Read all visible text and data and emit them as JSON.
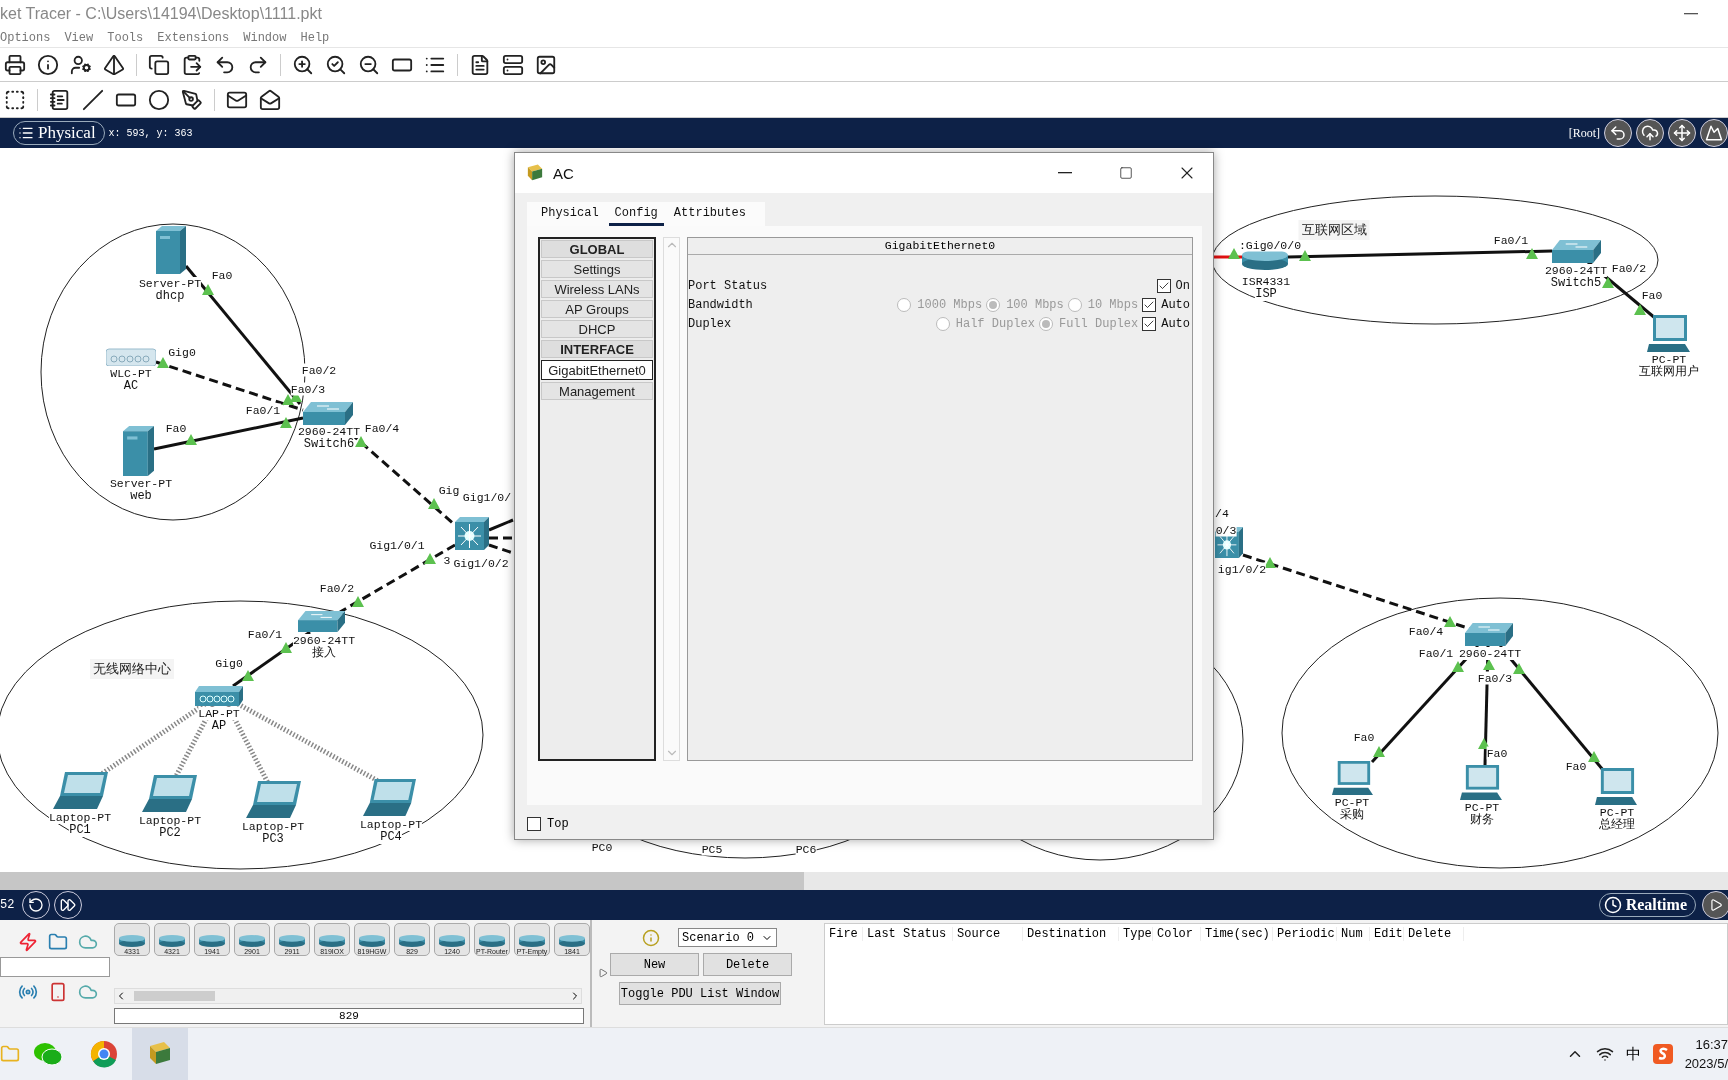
{
  "window": {
    "title": "ket Tracer - C:\\Users\\14194\\Desktop\\1111.pkt"
  },
  "menu": [
    "Options",
    "View",
    "Tools",
    "Extensions",
    "Window",
    "Help"
  ],
  "canvas_bar": {
    "mode": "Physical",
    "coords": "x: 593, y: 363",
    "path": "[Root]"
  },
  "canvas": {
    "nodes": [
      {
        "kind": "server",
        "model": "Server-PT",
        "name": "dhcp"
      },
      {
        "kind": "wlc",
        "model": "WLC-PT",
        "name": "AC"
      },
      {
        "kind": "server",
        "model": "Server-PT",
        "name": "web"
      },
      {
        "kind": "switch",
        "model": "2960-24TT",
        "name": "Switch6"
      },
      {
        "kind": "multilayer"
      },
      {
        "kind": "switch",
        "model": "2960-24TT",
        "name": "接入"
      },
      {
        "kind": "ap",
        "model": "LAP-PT",
        "name": "AP"
      },
      {
        "kind": "laptop",
        "model": "Laptop-PT",
        "name": "PC1"
      },
      {
        "kind": "laptop",
        "model": "Laptop-PT",
        "name": "PC2"
      },
      {
        "kind": "laptop",
        "model": "Laptop-PT",
        "name": "PC3"
      },
      {
        "kind": "laptop",
        "model": "Laptop-PT",
        "name": "PC4"
      },
      {
        "kind": "router",
        "model": "ISR4331",
        "name": "ISP"
      },
      {
        "kind": "switch",
        "model": "2960-24TT",
        "name": "Switch5"
      },
      {
        "kind": "pc",
        "model": "PC-PT",
        "name": "互联网用户"
      },
      {
        "kind": "multilayer"
      },
      {
        "kind": "switch",
        "model": "2960-24TT"
      },
      {
        "kind": "pc",
        "model": "PC-PT",
        "name": "采购"
      },
      {
        "kind": "pc",
        "model": "PC-PT",
        "name": "财务"
      },
      {
        "kind": "pc",
        "model": "PC-PT",
        "name": "总经理"
      }
    ],
    "area_labels": [
      "无线网络中心",
      "互联网区域"
    ],
    "labels": [
      "Fa0",
      "Gig0",
      "Fa0/2",
      "Fa0/3",
      "Fa0/1",
      "Fa0",
      "Fa0/4",
      "Gig",
      "Gig1/0/",
      "Gig1/0/1",
      "3",
      "Gig1/0/2",
      "Fa0/2",
      "Fa0/1",
      "Gig0",
      ":Gig0/0/0",
      "Fa0/1",
      "Fa0/2",
      "Fa0",
      "/4",
      "0/3",
      "ig1/0/2",
      "Fa0/4",
      "Fa0/1",
      "Fa0/3",
      "Fa0",
      "Fa0",
      "Fa0",
      "PC0",
      "PC5",
      "PC6"
    ]
  },
  "dialog": {
    "title": "AC",
    "tabs": [
      {
        "label": "Physical",
        "selected": false
      },
      {
        "label": "Config",
        "selected": true
      },
      {
        "label": "Attributes",
        "selected": false
      }
    ],
    "sidebar": [
      {
        "kind": "header",
        "label": "GLOBAL"
      },
      {
        "kind": "item",
        "label": "Settings",
        "selected": false
      },
      {
        "kind": "item",
        "label": "Wireless LANs",
        "selected": false
      },
      {
        "kind": "item",
        "label": "AP Groups",
        "selected": false
      },
      {
        "kind": "item",
        "label": "DHCP",
        "selected": false
      },
      {
        "kind": "header",
        "label": "INTERFACE"
      },
      {
        "kind": "item",
        "label": "GigabitEthernet0",
        "selected": true
      },
      {
        "kind": "item",
        "label": "Management",
        "selected": false
      }
    ],
    "panel_title": "GigabitEthernet0",
    "port_status": {
      "label": "Port Status",
      "on_label": "On",
      "checked": true
    },
    "settings": [
      {
        "label": "Bandwidth",
        "disabled": true,
        "options": [
          {
            "label": "1000 Mbps",
            "selected": false
          },
          {
            "label": "100 Mbps",
            "selected": true
          },
          {
            "label": "10 Mbps",
            "selected": false
          }
        ],
        "auto_label": "Auto",
        "auto": true
      },
      {
        "label": "Duplex",
        "disabled": true,
        "options": [
          {
            "label": "Half Duplex",
            "selected": false
          },
          {
            "label": "Full Duplex",
            "selected": true
          }
        ],
        "auto_label": "Auto",
        "auto": true
      }
    ],
    "top": {
      "label": "Top",
      "checked": false
    }
  },
  "realtime_bar": {
    "time": "52",
    "mode": "Realtime"
  },
  "palette": {
    "devices": [
      "4331",
      "4321",
      "1941",
      "2901",
      "2911",
      "819IOX",
      "819HGW",
      "829",
      "1240",
      "PT-Router",
      "PT-Empty",
      "1841"
    ],
    "selected_label": "829"
  },
  "pdu": {
    "scenario": "Scenario 0",
    "buttons": [
      "New",
      "Delete"
    ],
    "toggle": "Toggle PDU List Window",
    "columns": [
      "Fire",
      "Last Status",
      "Source",
      "Destination",
      "Type",
      "Color",
      "Time(sec)",
      "Periodic",
      "Num",
      "Edit",
      "Delete"
    ]
  },
  "taskbar": {
    "ime": "中",
    "time": "16:37",
    "date": "2023/5/"
  }
}
